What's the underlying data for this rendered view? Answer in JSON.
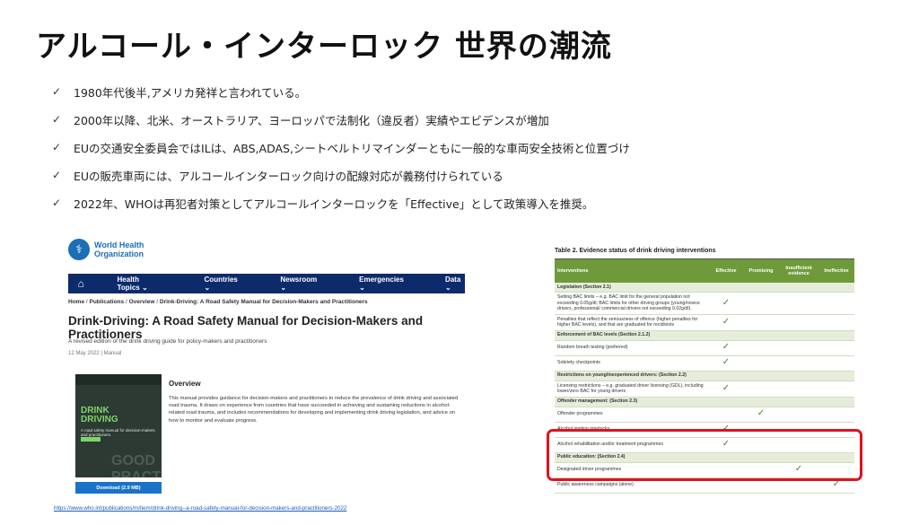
{
  "slide": {
    "title": "アルコール・インターロック 世界の潮流",
    "bullets": [
      "1980年代後半,アメリカ発祥と言われている。",
      "2000年以降、北米、オーストラリア、ヨーロッパで法制化（違反者）実績やエビデンスが増加",
      "EUの交通安全委員会ではILは、ABS,ADAS,シートベルトリマインダーともに一般的な車両安全技術と位置づけ",
      "EUの販売車両には、アルコールインターロック向けの配線対応が義務付けられている",
      "2022年、WHOは再犯者対策としてアルコールインターロックを「Effective」として政策導入を推奨。"
    ],
    "check_glyph": "✓"
  },
  "who_page": {
    "org_name": "World Health Organization",
    "nav": [
      "Health Topics ⌄",
      "Countries ⌄",
      "Newsroom ⌄",
      "Emergencies ⌄",
      "Data ⌄"
    ],
    "breadcrumb": {
      "home": "Home",
      "publications": "Publications",
      "overview": "Overview",
      "current": "Drink-Driving: A Road Safety Manual for Decision-Makers and Practitioners"
    },
    "title": "Drink-Driving: A Road Safety Manual for Decision-Makers and Practitioners",
    "subtitle": "A revised edition of the drink driving guide for policy-makers and practitioners",
    "date": "12 May 2022 | Manual",
    "cover_title": "DRINK DRIVING",
    "cover_sub": "A road safety manual for decision-makers and practitioners",
    "cover_text": "GOOD PRACTICE",
    "download_label": "Download (2.9 MB)",
    "overview_heading": "Overview",
    "overview_body": "This manual provides guidance for decision-makers and practitioners to reduce the prevalence of drink driving and associated road trauma. It draws on experience from countries that have succeeded in achieving and sustaining reductions in alcohol-related road trauma, and includes recommendations for developing and implementing drink driving legislation, and advice on how to monitor and evaluate progress.",
    "url": "https://www.who.int/publications/m/item/drink-driving--a-road-safety-manual-for-decision-makers-and-practitioners-2022"
  },
  "evidence_table": {
    "title": "Table 2. Evidence status of drink driving interventions",
    "headers": [
      "Interventions",
      "Effective",
      "Promising",
      "Insufficient evidence",
      "Ineffective"
    ],
    "check_glyph": "✓",
    "rows": [
      {
        "type": "section",
        "label": "Legislation (Section 2.1)"
      },
      {
        "type": "row",
        "label": "Setting BAC limits – e.g. BAC limit for the general population not exceeding 0.05g/dl; BAC limits for other driving groups (young/novice drivers, professional/ commercial drivers not exceeding 0.02g/dl).",
        "status": "Effective"
      },
      {
        "type": "row",
        "label": "Penalties that reflect the seriousness of offence (higher penalties for higher BAC levels), and that are graduated for recidivists",
        "status": "Effective"
      },
      {
        "type": "section",
        "label": "Enforcement of BAC levels (Section 2.1.2)"
      },
      {
        "type": "row",
        "label": "Random breath testing (preferred)",
        "status": "Effective"
      },
      {
        "type": "row",
        "label": "Sobriety checkpoints",
        "status": "Effective"
      },
      {
        "type": "section",
        "label": "Restrictions on young/inexperienced drivers: (Section 2.2)"
      },
      {
        "type": "row",
        "label": "Licensing restrictions – e.g. graduated driver licensing (GDL), including lower/zero BAC for young drivers",
        "status": "Effective"
      },
      {
        "type": "section",
        "label": "Offender management: (Section 2.3)"
      },
      {
        "type": "row",
        "label": "Offender programmes",
        "status": "Promising"
      },
      {
        "type": "row",
        "label": "Alcohol ignition interlocks",
        "status": "Effective"
      },
      {
        "type": "row",
        "label": "Alcohol rehabilitation and/or treatment programmes",
        "status": "Effective"
      },
      {
        "type": "section",
        "label": "Public education: (Section 2.4)"
      },
      {
        "type": "row",
        "label": "Designated driver programmes",
        "status": "Insufficient evidence"
      },
      {
        "type": "row",
        "label": "Public awareness campaigns (alone)",
        "status": "Ineffective"
      }
    ]
  },
  "colors": {
    "who_nav": "#0d2a6b",
    "who_blue": "#1a6fb5",
    "table_header": "#6f9a3a",
    "section_row": "#e6eddb",
    "check": "#4f7d2c",
    "highlight": "#e0121f"
  }
}
